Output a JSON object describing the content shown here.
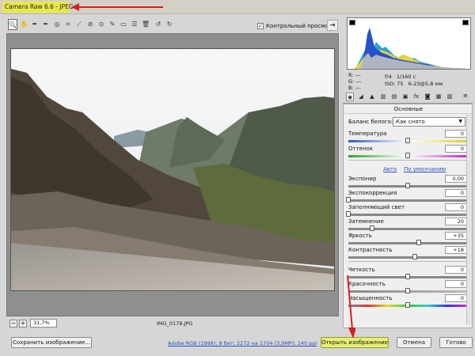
{
  "window": {
    "title": "Camera Raw 6.6  -  JPEG"
  },
  "toolbar": {
    "tools": [
      {
        "icon": "zoom-icon",
        "glyph": "🔍"
      },
      {
        "icon": "hand-icon",
        "glyph": "✋"
      },
      {
        "icon": "white-balance-icon",
        "glyph": "✒"
      },
      {
        "icon": "color-sampler-icon",
        "glyph": "✒"
      },
      {
        "icon": "target-adjust-icon",
        "glyph": "◎"
      },
      {
        "icon": "crop-icon",
        "glyph": "⌗"
      },
      {
        "icon": "straighten-icon",
        "glyph": "⟋"
      },
      {
        "icon": "spot-removal-icon",
        "glyph": "⊘"
      },
      {
        "icon": "red-eye-icon",
        "glyph": "⊙"
      },
      {
        "icon": "adjustment-brush-icon",
        "glyph": "✎"
      },
      {
        "icon": "graduated-filter-icon",
        "glyph": "▭"
      },
      {
        "icon": "preferences-icon",
        "glyph": "☰"
      },
      {
        "icon": "trash-icon",
        "glyph": "🗑"
      },
      {
        "icon": "rotate-ccw-icon",
        "glyph": "↺"
      },
      {
        "icon": "rotate-cw-icon",
        "glyph": "↻"
      }
    ],
    "preview_label": "Контрольный просмотр",
    "preview_checked": "✓",
    "fullscreen_glyph": "⇥"
  },
  "status": {
    "zoom_minus": "−",
    "zoom_plus": "+",
    "zoom_value": "31,7%",
    "filename": "IMG_0178.JPG"
  },
  "readout": {
    "r_label": "R:",
    "r_value": "---",
    "g_label": "G:",
    "g_value": "---",
    "b_label": "B:",
    "b_value": "---",
    "aperture": "f/4",
    "shutter": "1/160 с",
    "iso": "ISO: 75",
    "focal": "6-23@5,8 мм"
  },
  "panel_tabs": [
    {
      "icon": "basic-icon",
      "glyph": "◉"
    },
    {
      "icon": "tone-curve-icon",
      "glyph": "◢"
    },
    {
      "icon": "detail-icon",
      "glyph": "▲"
    },
    {
      "icon": "hsl-icon",
      "glyph": "▥"
    },
    {
      "icon": "split-toning-icon",
      "glyph": "▤"
    },
    {
      "icon": "lens-corrections-icon",
      "glyph": "▣"
    },
    {
      "icon": "effects-icon",
      "glyph": "fx"
    },
    {
      "icon": "camera-calibration-icon",
      "glyph": "◙"
    },
    {
      "icon": "presets-icon",
      "glyph": "▦"
    },
    {
      "icon": "snapshots-icon",
      "glyph": "▧"
    }
  ],
  "panel": {
    "title": "Основные",
    "wb_label": "Баланс белого:",
    "wb_value": "Как снято",
    "wb_arrow": "▼",
    "auto_link": "Авто",
    "default_link": "По умолчанию",
    "sliders": [
      {
        "label": "Температура",
        "value": "0",
        "pos": 0.5,
        "kind": "temp"
      },
      {
        "label": "Оттенок",
        "value": "0",
        "pos": 0.5,
        "kind": "tint"
      },
      {
        "label": "Экспонир",
        "value": "0,00",
        "pos": 0.5,
        "kind": "gray"
      },
      {
        "label": "Экспокоррекция",
        "value": "0",
        "pos": 0.0,
        "kind": "gray"
      },
      {
        "label": "Заполняющий свет",
        "value": "0",
        "pos": 0.0,
        "kind": "gray"
      },
      {
        "label": "Затемнение",
        "value": "20",
        "pos": 0.2,
        "kind": "gray"
      },
      {
        "label": "Яркость",
        "value": "+35",
        "pos": 0.59,
        "kind": "gray"
      },
      {
        "label": "Контрастность",
        "value": "+18",
        "pos": 0.56,
        "kind": "gray"
      },
      {
        "label": "Четкость",
        "value": "0",
        "pos": 0.5,
        "kind": "gray"
      },
      {
        "label": "Красочность",
        "value": "0",
        "pos": 0.5,
        "kind": "vib"
      },
      {
        "label": "Насыщенность",
        "value": "0",
        "pos": 0.5,
        "kind": "sat"
      }
    ]
  },
  "bottom": {
    "save_label": "Сохранить изображение...",
    "workflow_link": "Adobe RGB (1998); 8 бит; 2272 на 1704 (3,9МР); 240 ppi",
    "open_label": "Открыть изображение",
    "cancel_label": "Отмена",
    "done_label": "Готово"
  },
  "colors": {
    "highlight": "#e8e84a",
    "annotation_arrow": "#d42020",
    "link": "#2a4fbf"
  }
}
